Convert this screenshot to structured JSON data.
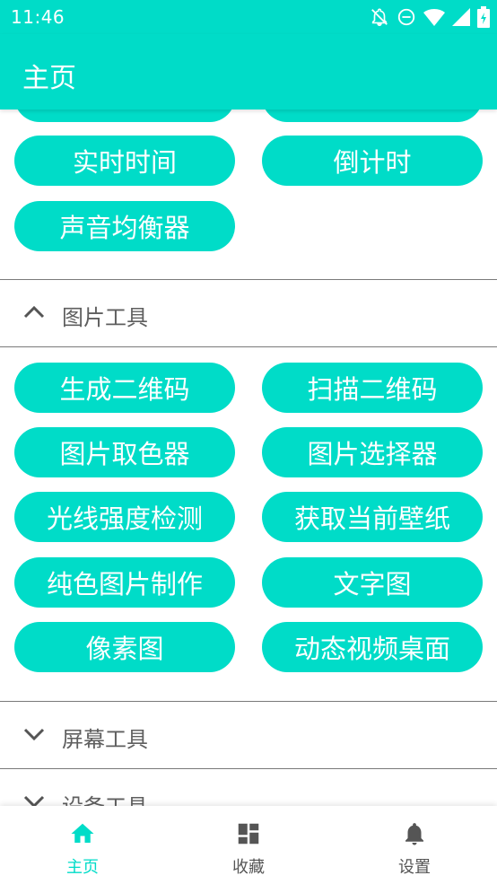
{
  "status_bar": {
    "time": "11:46",
    "icons": [
      "bell-off-icon",
      "do-not-disturb-icon",
      "wifi-icon",
      "signal-icon",
      "battery-icon"
    ]
  },
  "app_bar": {
    "title": "主页"
  },
  "colors": {
    "accent": "#00dcc8",
    "divider": "#7a7a7a",
    "text_muted": "#5f5f5f"
  },
  "top_group": {
    "items": [
      "实时时间",
      "倒计时",
      "声音均衡器"
    ]
  },
  "sections": [
    {
      "title": "图片工具",
      "expanded": true,
      "items": [
        "生成二维码",
        "扫描二维码",
        "图片取色器",
        "图片选择器",
        "光线强度检测",
        "获取当前壁纸",
        "纯色图片制作",
        "文字图",
        "像素图",
        "动态视频桌面"
      ]
    },
    {
      "title": "屏幕工具",
      "expanded": false
    },
    {
      "title": "设备工具",
      "expanded": false
    }
  ],
  "bottom_nav": {
    "items": [
      {
        "label": "主页",
        "icon": "home-icon",
        "active": true
      },
      {
        "label": "收藏",
        "icon": "dashboard-icon",
        "active": false
      },
      {
        "label": "设置",
        "icon": "bell-icon",
        "active": false
      }
    ]
  }
}
